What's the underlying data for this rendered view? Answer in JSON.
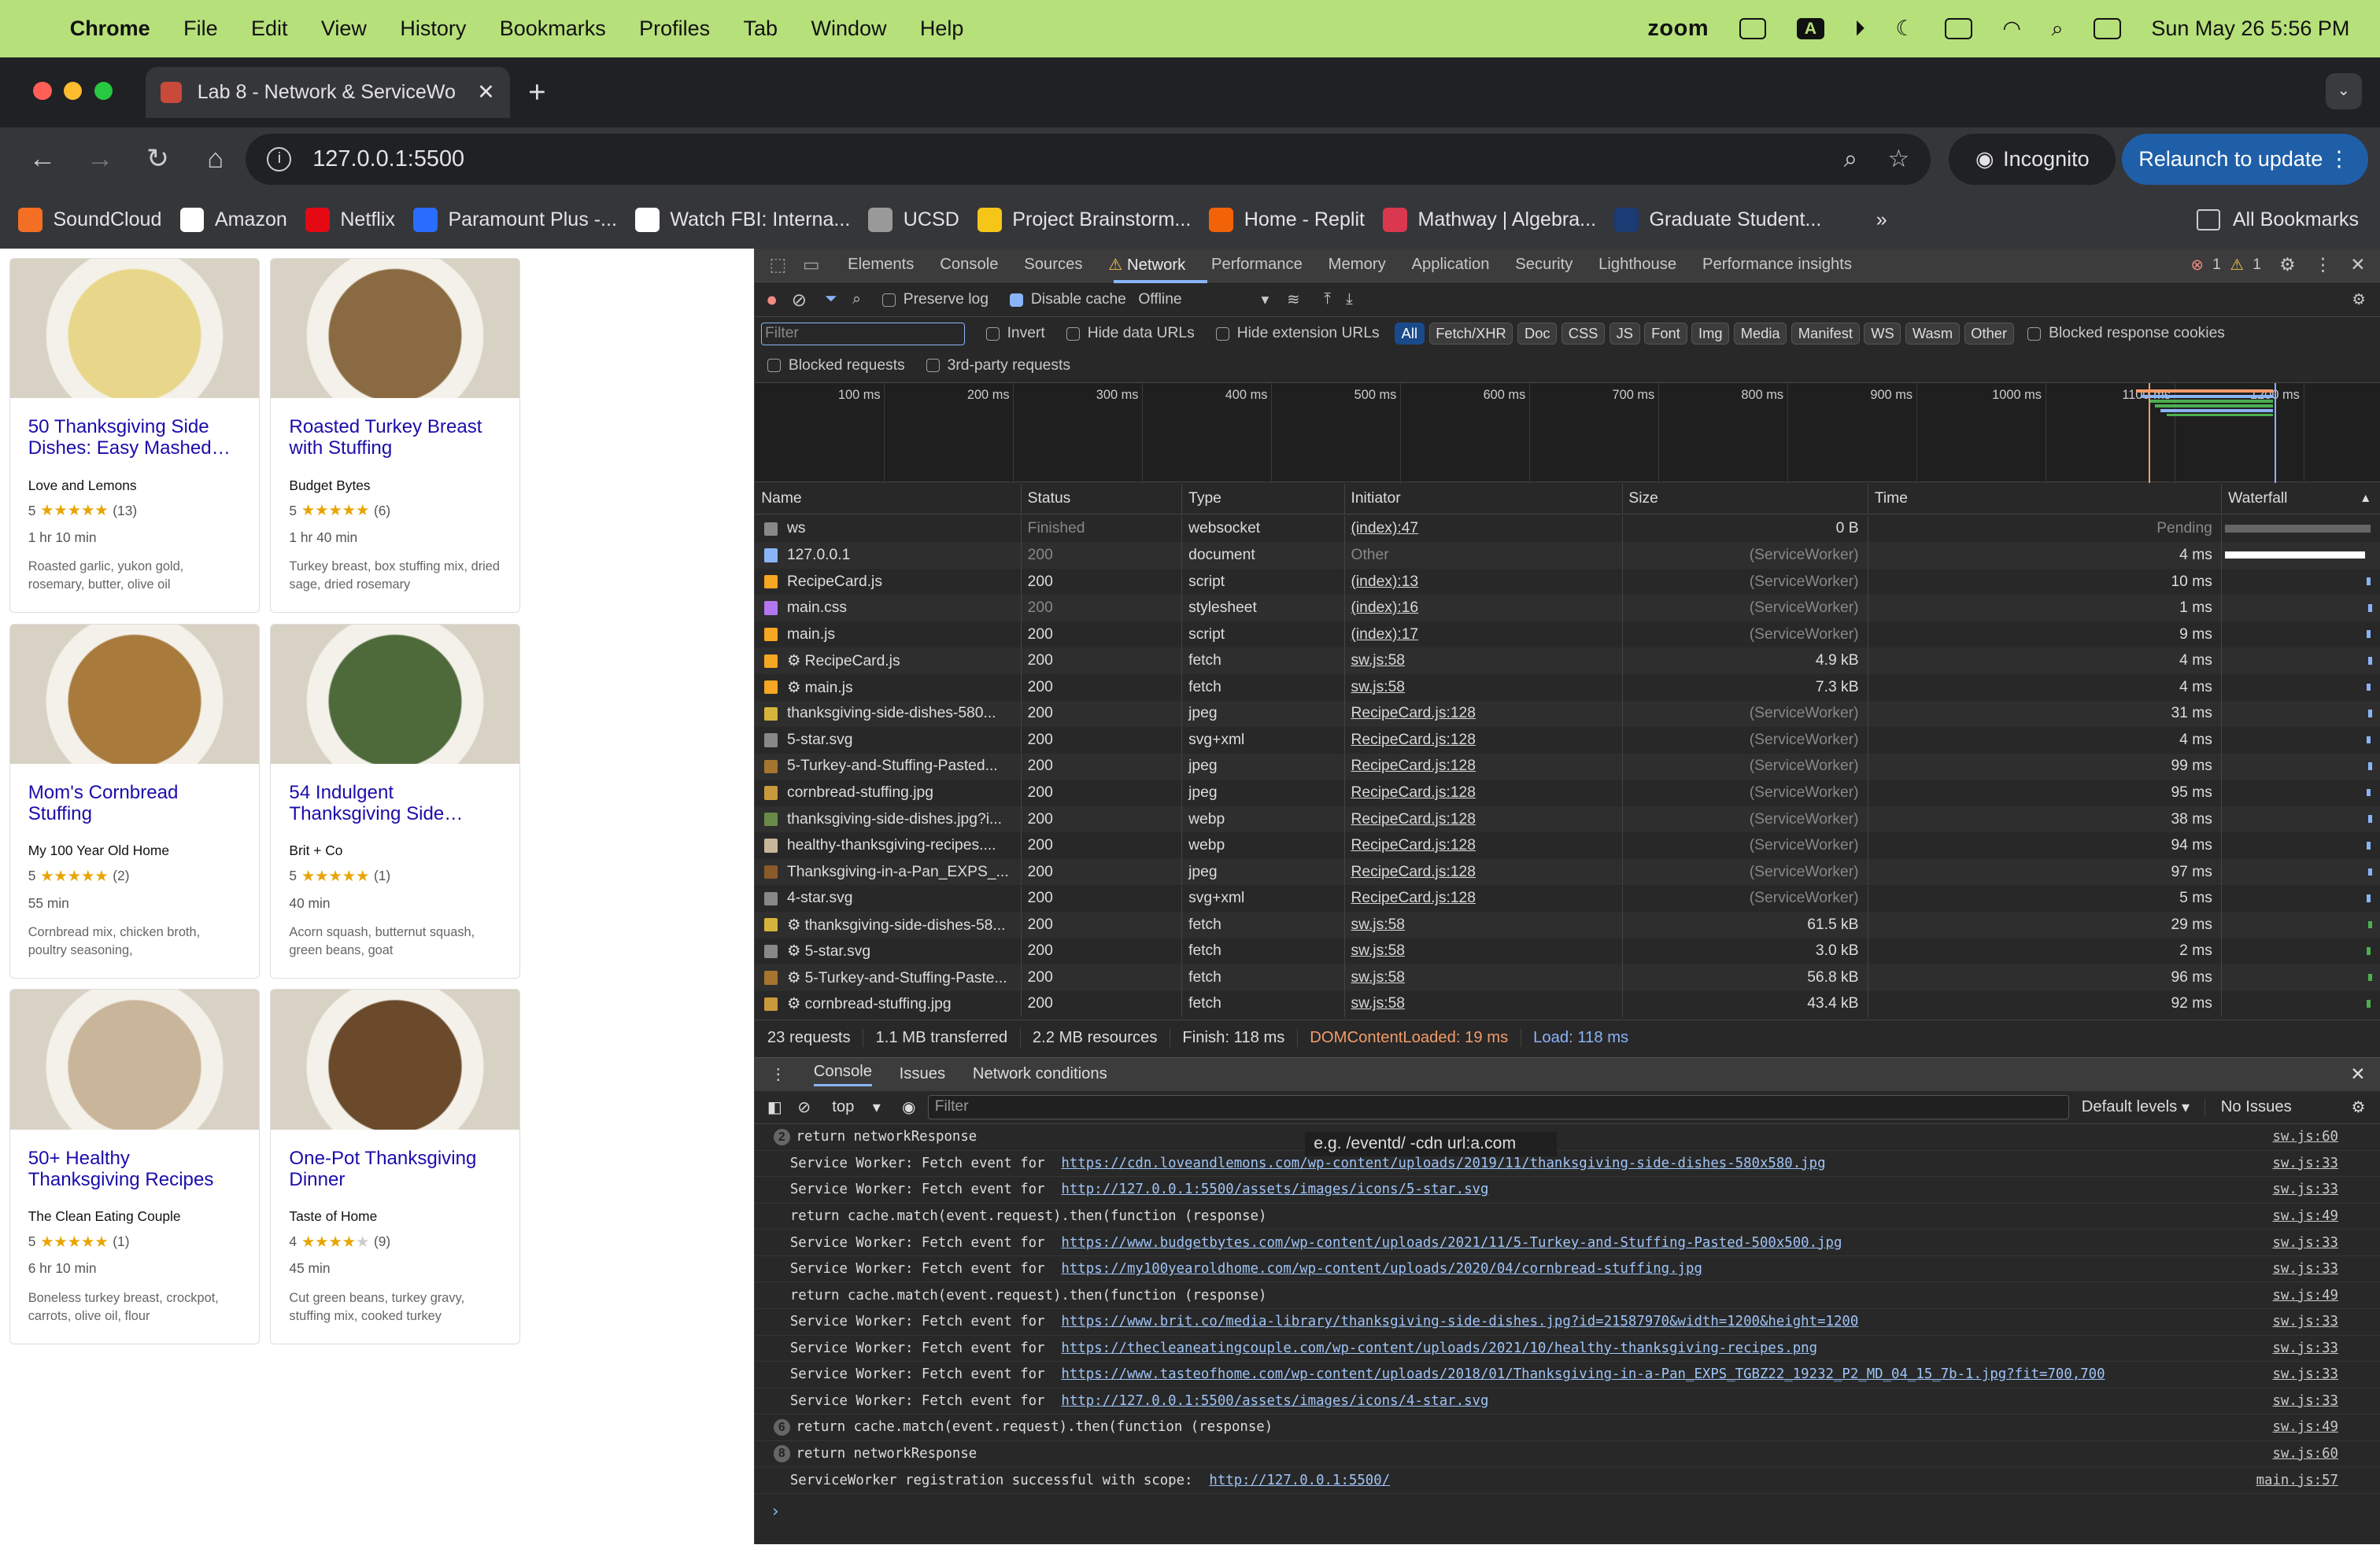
{
  "menubar": {
    "app": "Chrome",
    "items": [
      "File",
      "Edit",
      "View",
      "History",
      "Bookmarks",
      "Profiles",
      "Tab",
      "Window",
      "Help"
    ],
    "zoom": "zoom",
    "clock": "Sun May 26  5:56 PM"
  },
  "browser": {
    "tab_title": "Lab 8 - Network & ServiceWo",
    "url": "127.0.0.1:5500",
    "incognito": "Incognito",
    "relaunch": "Relaunch to update",
    "bookmarks": [
      {
        "label": "SoundCloud",
        "color": "#f26f23"
      },
      {
        "label": "Amazon",
        "color": "#ffffff"
      },
      {
        "label": "Netflix",
        "color": "#e50914"
      },
      {
        "label": "Paramount Plus -...",
        "color": "#2a6cff"
      },
      {
        "label": "Watch FBI: Interna...",
        "color": "#ffffff"
      },
      {
        "label": "UCSD",
        "color": "#999999"
      },
      {
        "label": "Project Brainstorm...",
        "color": "#f5c518"
      },
      {
        "label": "Home - Replit",
        "color": "#f26207"
      },
      {
        "label": "Mathway | Algebra...",
        "color": "#d9384e"
      },
      {
        "label": "Graduate Student...",
        "color": "#1a3b73"
      }
    ],
    "all_bookmarks": "All Bookmarks"
  },
  "recipes": [
    {
      "title": "50 Thanksgiving Side Dishes: Easy Mashed…",
      "org": "Love and Lemons",
      "rating": "5",
      "stars": 5,
      "count": "(13)",
      "time": "1 hr 10 min",
      "ingredients": "Roasted garlic, yukon gold, rosemary, butter, olive oil",
      "img": "#e8d78a"
    },
    {
      "title": "Roasted Turkey Breast with Stuffing",
      "org": "Budget Bytes",
      "rating": "5",
      "stars": 5,
      "count": "(6)",
      "time": "1 hr 40 min",
      "ingredients": "Turkey breast, box stuffing mix, dried sage, dried rosemary",
      "img": "#8a6a42"
    },
    {
      "title": "Mom's Cornbread Stuffing",
      "org": "My 100 Year Old Home",
      "rating": "5",
      "stars": 5,
      "count": "(2)",
      "time": "55 min",
      "ingredients": "Cornbread mix, chicken broth, poultry seasoning,",
      "img": "#a87a3c"
    },
    {
      "title": "54 Indulgent Thanksgiving Side…",
      "org": "Brit + Co",
      "rating": "5",
      "stars": 5,
      "count": "(1)",
      "time": "40 min",
      "ingredients": "Acorn squash, butternut squash, green beans, goat",
      "img": "#4e6a3a"
    },
    {
      "title": "50+ Healthy Thanksgiving Recipes",
      "org": "The Clean Eating Couple",
      "rating": "5",
      "stars": 5,
      "count": "(1)",
      "time": "6 hr 10 min",
      "ingredients": "Boneless turkey breast, crockpot, carrots, olive oil, flour",
      "img": "#c9b59a"
    },
    {
      "title": "One-Pot Thanksgiving Dinner",
      "org": "Taste of Home",
      "rating": "4",
      "stars": 4,
      "count": "(9)",
      "time": "45 min",
      "ingredients": "Cut green beans, turkey gravy, stuffing mix, cooked turkey",
      "img": "#6a4a2a"
    }
  ],
  "devtools": {
    "tabs": [
      "Elements",
      "Console",
      "Sources",
      "Network",
      "Performance",
      "Memory",
      "Application",
      "Security",
      "Lighthouse",
      "Performance insights"
    ],
    "errors": "1",
    "warnings": "1",
    "toolbar": {
      "preserve_log": "Preserve log",
      "disable_cache": "Disable cache",
      "throttle": "Offline"
    },
    "filter_placeholder": "Filter",
    "filter_opts": {
      "invert": "Invert",
      "hide_data": "Hide data URLs",
      "hide_ext": "Hide extension URLs",
      "blocked_cookies": "Blocked response cookies",
      "blocked_req": "Blocked requests",
      "third_party": "3rd-party requests"
    },
    "type_chips": [
      "All",
      "Fetch/XHR",
      "Doc",
      "CSS",
      "JS",
      "Font",
      "Img",
      "Media",
      "Manifest",
      "WS",
      "Wasm",
      "Other"
    ],
    "ticks": [
      "100 ms",
      "200 ms",
      "300 ms",
      "400 ms",
      "500 ms",
      "600 ms",
      "700 ms",
      "800 ms",
      "900 ms",
      "1000 ms",
      "1100 ms",
      "1200 ms"
    ],
    "columns": [
      "Name",
      "Status",
      "Type",
      "Initiator",
      "Size",
      "Time",
      "Waterfall"
    ],
    "requests": [
      {
        "icon": "⇄",
        "name": "ws",
        "status": "Finished",
        "type": "websocket",
        "initiator": "(index):47",
        "size": "0 B",
        "time": "Pending",
        "color": "#888"
      },
      {
        "icon": "▤",
        "name": "127.0.0.1",
        "status": "200",
        "type": "document",
        "initiator": "Other",
        "size": "(ServiceWorker)",
        "time": "4 ms",
        "color": "#8ab4f8"
      },
      {
        "icon": "▦",
        "name": "RecipeCard.js",
        "status": "200",
        "type": "script",
        "initiator": "(index):13",
        "size": "(ServiceWorker)",
        "time": "10 ms",
        "color": "#f5a623"
      },
      {
        "icon": "▦",
        "name": "main.css",
        "status": "200",
        "type": "stylesheet",
        "initiator": "(index):16",
        "size": "(ServiceWorker)",
        "time": "1 ms",
        "color": "#b277f0"
      },
      {
        "icon": "▦",
        "name": "main.js",
        "status": "200",
        "type": "script",
        "initiator": "(index):17",
        "size": "(ServiceWorker)",
        "time": "9 ms",
        "color": "#f5a623"
      },
      {
        "icon": "▦",
        "name": "⚙ RecipeCard.js",
        "status": "200",
        "type": "fetch",
        "initiator": "sw.js:58",
        "size": "4.9 kB",
        "time": "4 ms",
        "color": "#f5a623"
      },
      {
        "icon": "▦",
        "name": "⚙ main.js",
        "status": "200",
        "type": "fetch",
        "initiator": "sw.js:58",
        "size": "7.3 kB",
        "time": "4 ms",
        "color": "#f5a623"
      },
      {
        "icon": "▦",
        "name": "thanksgiving-side-dishes-580...",
        "status": "200",
        "type": "jpeg",
        "initiator": "RecipeCard.js:128",
        "size": "(ServiceWorker)",
        "time": "31 ms",
        "color": "#d4b43a"
      },
      {
        "icon": "⋯",
        "name": "5-star.svg",
        "status": "200",
        "type": "svg+xml",
        "initiator": "RecipeCard.js:128",
        "size": "(ServiceWorker)",
        "time": "4 ms",
        "color": "#888"
      },
      {
        "icon": "▦",
        "name": "5-Turkey-and-Stuffing-Pasted...",
        "status": "200",
        "type": "jpeg",
        "initiator": "RecipeCard.js:128",
        "size": "(ServiceWorker)",
        "time": "99 ms",
        "color": "#a5742e"
      },
      {
        "icon": "▦",
        "name": "cornbread-stuffing.jpg",
        "status": "200",
        "type": "jpeg",
        "initiator": "RecipeCard.js:128",
        "size": "(ServiceWorker)",
        "time": "95 ms",
        "color": "#c99a3c"
      },
      {
        "icon": "▦",
        "name": "thanksgiving-side-dishes.jpg?i...",
        "status": "200",
        "type": "webp",
        "initiator": "RecipeCard.js:128",
        "size": "(ServiceWorker)",
        "time": "38 ms",
        "color": "#6a8a4a"
      },
      {
        "icon": "▦",
        "name": "healthy-thanksgiving-recipes....",
        "status": "200",
        "type": "webp",
        "initiator": "RecipeCard.js:128",
        "size": "(ServiceWorker)",
        "time": "94 ms",
        "color": "#c9b59a"
      },
      {
        "icon": "▦",
        "name": "Thanksgiving-in-a-Pan_EXPS_...",
        "status": "200",
        "type": "jpeg",
        "initiator": "RecipeCard.js:128",
        "size": "(ServiceWorker)",
        "time": "97 ms",
        "color": "#8a5a2a"
      },
      {
        "icon": "⋯",
        "name": "4-star.svg",
        "status": "200",
        "type": "svg+xml",
        "initiator": "RecipeCard.js:128",
        "size": "(ServiceWorker)",
        "time": "5 ms",
        "color": "#888"
      },
      {
        "icon": "▦",
        "name": "⚙ thanksgiving-side-dishes-58...",
        "status": "200",
        "type": "fetch",
        "initiator": "sw.js:58",
        "size": "61.5 kB",
        "time": "29 ms",
        "color": "#d4b43a"
      },
      {
        "icon": "⋯",
        "name": "⚙ 5-star.svg",
        "status": "200",
        "type": "fetch",
        "initiator": "sw.js:58",
        "size": "3.0 kB",
        "time": "2 ms",
        "color": "#888"
      },
      {
        "icon": "▦",
        "name": "⚙ 5-Turkey-and-Stuffing-Paste...",
        "status": "200",
        "type": "fetch",
        "initiator": "sw.js:58",
        "size": "56.8 kB",
        "time": "96 ms",
        "color": "#a5742e"
      },
      {
        "icon": "▦",
        "name": "⚙ cornbread-stuffing.jpg",
        "status": "200",
        "type": "fetch",
        "initiator": "sw.js:58",
        "size": "43.4 kB",
        "time": "92 ms",
        "color": "#c99a3c"
      }
    ],
    "summary": {
      "requests": "23 requests",
      "transferred": "1.1 MB transferred",
      "resources": "2.2 MB resources",
      "finish": "Finish: 118 ms",
      "dcl": "DOMContentLoaded: 19 ms",
      "load": "Load: 118 ms"
    },
    "drawer_tabs": [
      "Console",
      "Issues",
      "Network conditions"
    ],
    "console_toolbar": {
      "context": "top",
      "filter": "Filter",
      "levels": "Default levels",
      "issues": "No Issues"
    },
    "tooltip": "e.g. /eventd/ -cdn url:a.com",
    "console": [
      {
        "badge": "2",
        "text": "return networkResponse",
        "link": "",
        "src": "sw.js:60"
      },
      {
        "badge": "",
        "text": "Service Worker: Fetch event for  ",
        "link": "https://cdn.loveandlemons.com/wp-content/uploads/2019/11/thanksgiving-side-dishes-580x580.jpg",
        "src": "sw.js:33"
      },
      {
        "badge": "",
        "text": "Service Worker: Fetch event for  ",
        "link": "http://127.0.0.1:5500/assets/images/icons/5-star.svg",
        "src": "sw.js:33"
      },
      {
        "badge": "",
        "text": "return cache.match(event.request).then(function (response)",
        "link": "",
        "src": "sw.js:49"
      },
      {
        "badge": "",
        "text": "Service Worker: Fetch event for  ",
        "link": "https://www.budgetbytes.com/wp-content/uploads/2021/11/5-Turkey-and-Stuffing-Pasted-500x500.jpg",
        "src": "sw.js:33"
      },
      {
        "badge": "",
        "text": "Service Worker: Fetch event for  ",
        "link": "https://my100yearoldhome.com/wp-content/uploads/2020/04/cornbread-stuffing.jpg",
        "src": "sw.js:33"
      },
      {
        "badge": "",
        "text": "return cache.match(event.request).then(function (response)",
        "link": "",
        "src": "sw.js:49"
      },
      {
        "badge": "",
        "text": "Service Worker: Fetch event for  ",
        "link": "https://www.brit.co/media-library/thanksgiving-side-dishes.jpg?id=21587970&width=1200&height=1200",
        "src": "sw.js:33"
      },
      {
        "badge": "",
        "text": "Service Worker: Fetch event for  ",
        "link": "https://thecleaneatingcouple.com/wp-content/uploads/2021/10/healthy-thanksgiving-recipes.png",
        "src": "sw.js:33"
      },
      {
        "badge": "",
        "text": "Service Worker: Fetch event for  ",
        "link": "https://www.tasteofhome.com/wp-content/uploads/2018/01/Thanksgiving-in-a-Pan_EXPS_TGBZ22_19232_P2_MD_04_15_7b-1.jpg?fit=700,700",
        "src": "sw.js:33"
      },
      {
        "badge": "",
        "text": "Service Worker: Fetch event for  ",
        "link": "http://127.0.0.1:5500/assets/images/icons/4-star.svg",
        "src": "sw.js:33"
      },
      {
        "badge": "6",
        "text": "return cache.match(event.request).then(function (response)",
        "link": "",
        "src": "sw.js:49"
      },
      {
        "badge": "8",
        "text": "return networkResponse",
        "link": "",
        "src": "sw.js:60"
      },
      {
        "badge": "",
        "text": "ServiceWorker registration successful with scope:  ",
        "link": "http://127.0.0.1:5500/",
        "src": "main.js:57"
      }
    ]
  }
}
